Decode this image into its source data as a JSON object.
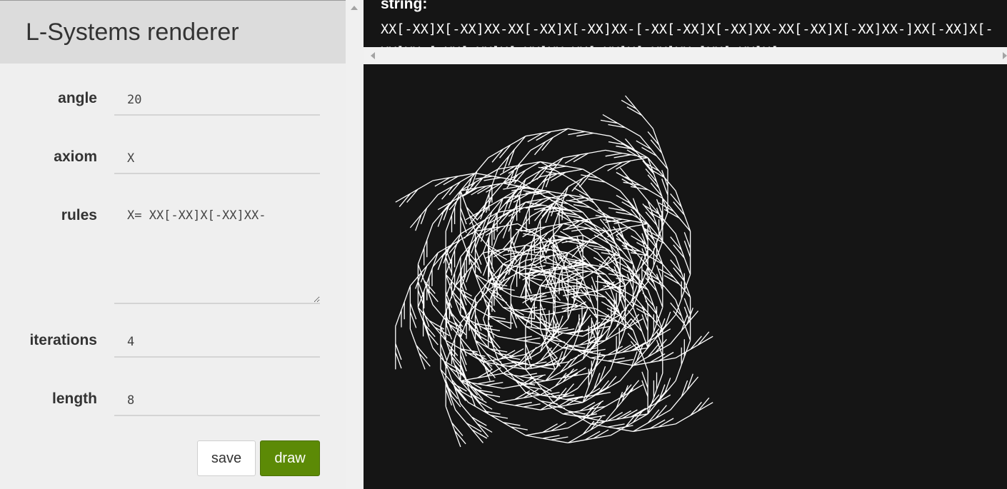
{
  "app": {
    "title": "L-Systems renderer"
  },
  "form": {
    "angle": {
      "label": "angle",
      "value": "20"
    },
    "axiom": {
      "label": "axiom",
      "value": "X"
    },
    "rules": {
      "label": "rules",
      "value": "X= XX[-XX]X[-XX]XX-"
    },
    "iterations": {
      "label": "iterations",
      "value": "4"
    },
    "length": {
      "label": "length",
      "value": "8"
    }
  },
  "buttons": {
    "save": "save",
    "draw": "draw"
  },
  "output": {
    "label": "string:",
    "text": "XX[-XX]X[-XX]XX-XX[-XX]X[-XX]XX-[-XX[-XX]X[-XX]XX-XX[-XX]X[-XX]XX-]XX[-XX]X[-XX]XX-[-XX[-XX]X[-XX]XX-XX[-XX]X[-XX]XX-]XX[-XX]X[-"
  },
  "colors": {
    "accent": "#5c8a06",
    "canvas_bg": "#151515",
    "stroke": "#ffffff"
  }
}
